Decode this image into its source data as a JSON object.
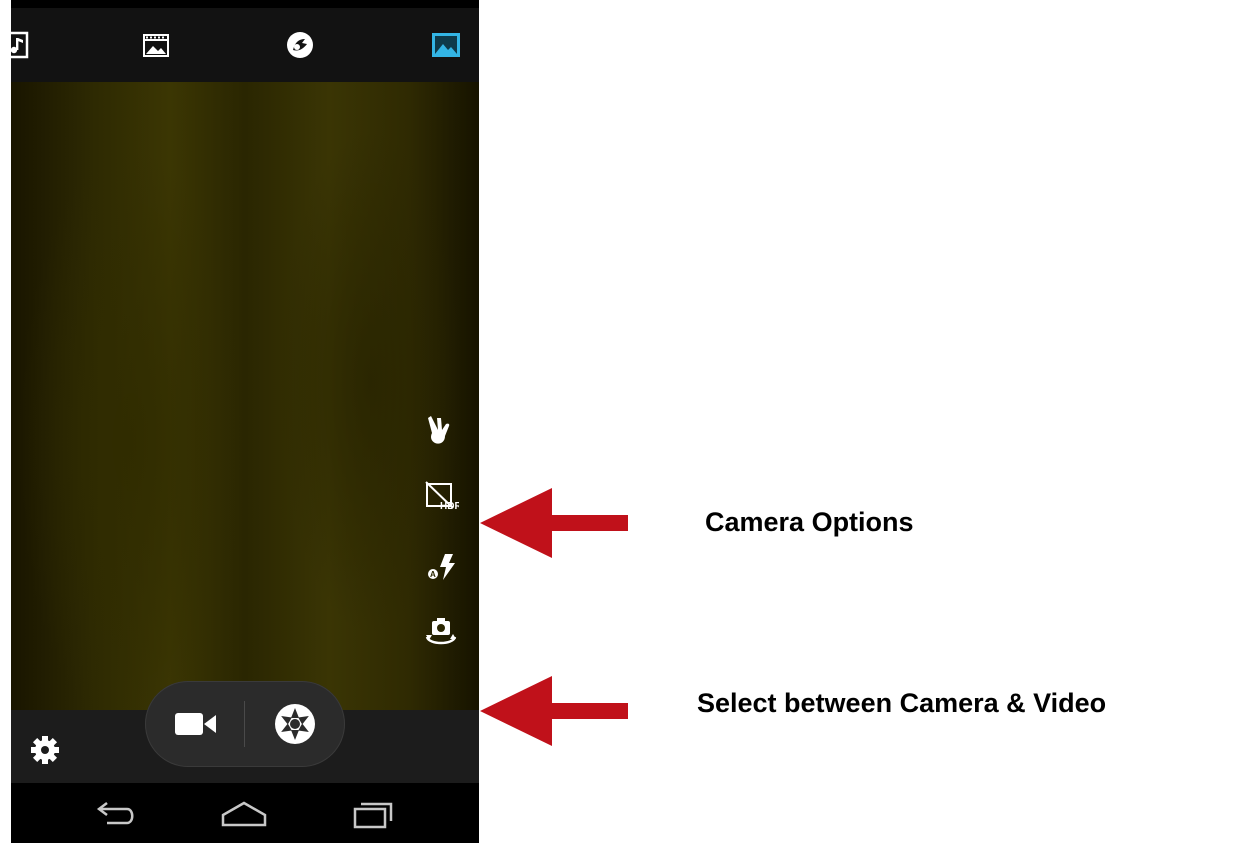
{
  "top_tabs": [
    {
      "icon": "music-note-icon"
    },
    {
      "icon": "film-frame-icon"
    },
    {
      "icon": "panorama-icon"
    },
    {
      "icon": "gallery-icon",
      "active": true
    }
  ],
  "camera_options": [
    {
      "icon": "gesture-shot-icon"
    },
    {
      "icon": "hdr-off-icon",
      "text": "HDR"
    },
    {
      "icon": "flash-auto-icon",
      "text": "A"
    },
    {
      "icon": "switch-camera-icon"
    }
  ],
  "mode_switcher": [
    {
      "icon": "video-camera-icon"
    },
    {
      "icon": "shutter-icon"
    }
  ],
  "settings": {
    "icon": "gear-icon"
  },
  "navigation": [
    {
      "icon": "back-icon"
    },
    {
      "icon": "home-icon"
    },
    {
      "icon": "recent-apps-icon"
    }
  ],
  "annotations": {
    "camera_options_label": "Camera Options",
    "mode_select_label": "Select between Camera & Video"
  },
  "colors": {
    "arrow": "#c0111a",
    "active_tab": "#33b5e5",
    "icon": "#ffffff"
  }
}
